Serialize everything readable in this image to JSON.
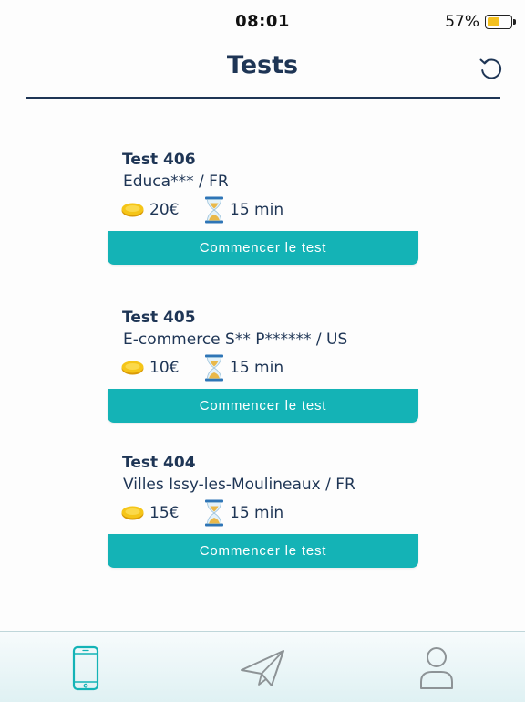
{
  "status_bar": {
    "time": "08:01",
    "battery_percent": "57%",
    "battery_level": 0.57,
    "battery_color": "#f4c01e"
  },
  "header": {
    "title": "Tests",
    "refresh_icon": "refresh-icon"
  },
  "tests": [
    {
      "title": "Test 406",
      "subtitle": "Educa*** / FR",
      "price": "20€",
      "duration": "15 min",
      "button_label": "Commencer le test"
    },
    {
      "title": "Test 405",
      "subtitle": "E-commerce S** P****** / US",
      "price": "10€",
      "duration": "15 min",
      "button_label": "Commencer le test"
    },
    {
      "title": "Test 404",
      "subtitle": "Villes Issy-les-Moulineaux / FR",
      "price": "15€",
      "duration": "15 min",
      "button_label": "Commencer le test"
    }
  ],
  "tab_bar": {
    "items": [
      {
        "icon": "phone-icon",
        "active": true
      },
      {
        "icon": "paper-plane-icon",
        "active": false
      },
      {
        "icon": "user-icon",
        "active": false
      }
    ],
    "active_color": "#14b3b6",
    "inactive_color": "#8d9396"
  },
  "colors": {
    "accent": "#14b3b6",
    "text": "#1e3555"
  }
}
